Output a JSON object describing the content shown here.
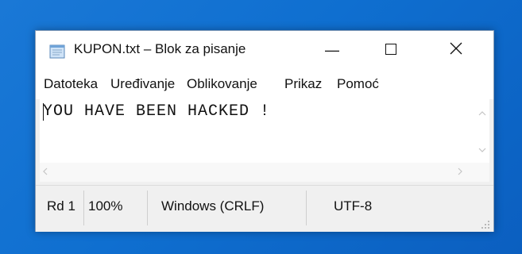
{
  "window": {
    "title": "KUPON.txt – Blok za pisanje",
    "controls": {
      "minimize": "—",
      "maximize": "☐",
      "close": "✕"
    }
  },
  "menu": {
    "items": [
      "Datoteka",
      "Uređivanje",
      "Oblikovanje",
      "Prikaz",
      "Pomoć"
    ]
  },
  "editor": {
    "content": "YOU HAVE BEEN HACKED !"
  },
  "scrollbars": {
    "up_arrow": "⌃",
    "down_arrow": "⌄",
    "left_arrow": "‹",
    "right_arrow": "›"
  },
  "status": {
    "position": "Rd 1",
    "zoom": "100%",
    "line_ending": "Windows (CRLF)",
    "encoding": "UTF-8"
  },
  "colors": {
    "desktop": "#0f6fd0",
    "window_bg": "#f0f0f0",
    "titlebar_bg": "#ffffff"
  },
  "icons": {
    "app": "notepad-icon",
    "grip": "resize-grip-icon"
  }
}
